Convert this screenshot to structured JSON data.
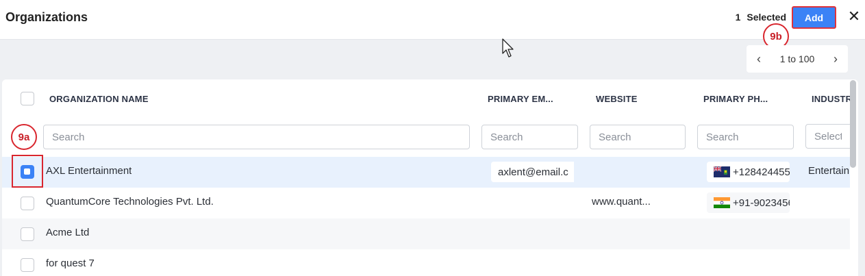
{
  "header": {
    "title": "Organizations",
    "selected_count": "1",
    "selected_label": "Selected",
    "add_label": "Add",
    "close_glyph": "✕"
  },
  "annotations": {
    "badge_9a": "9a",
    "badge_9b": "9b"
  },
  "pager": {
    "prev": "‹",
    "range": "1 to 100",
    "next": "›"
  },
  "columns": [
    {
      "label": "ORGANIZATION NAME"
    },
    {
      "label": "PRIMARY EM..."
    },
    {
      "label": "WEBSITE"
    },
    {
      "label": "PRIMARY PH..."
    },
    {
      "label": "INDUSTR"
    }
  ],
  "filters": {
    "name_placeholder": "Search",
    "email_placeholder": "Search",
    "website_placeholder": "Search",
    "phone_placeholder": "Search",
    "industry_placeholder": "Select"
  },
  "rows": [
    {
      "name": "AXL Entertainment",
      "email": "axlent@email.c",
      "website": "",
      "phone": "+128424455",
      "phone_flag": "flag-icon-vg",
      "industry": "Entertain",
      "checked": true
    },
    {
      "name": "QuantumCore Technologies Pvt. Ltd.",
      "email": "",
      "website": "www.quant...",
      "phone": "+91-9023456",
      "phone_flag": "flag-icon-in",
      "industry": "",
      "checked": false
    },
    {
      "name": "Acme Ltd",
      "email": "",
      "website": "",
      "phone": "",
      "industry": "",
      "checked": false
    },
    {
      "name": "for quest 7",
      "email": "",
      "website": "",
      "phone": "",
      "industry": "",
      "checked": false
    }
  ],
  "colors": {
    "accent": "#3b82f6",
    "annotation_red": "#d9262e",
    "selected_row": "#e8f1fd"
  }
}
